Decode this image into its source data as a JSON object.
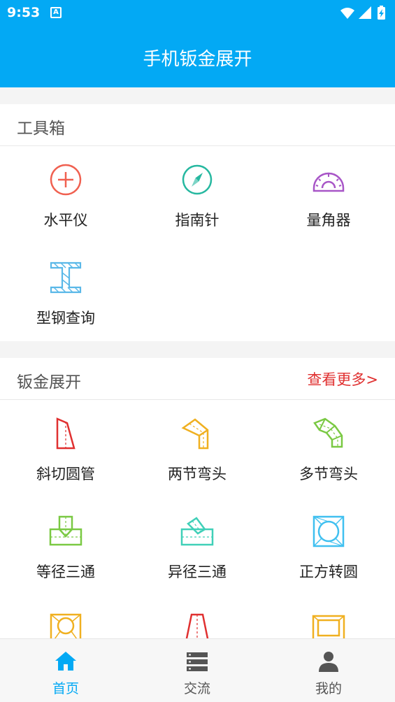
{
  "status_bar": {
    "time": "9:53",
    "notification": "A"
  },
  "app_bar": {
    "title": "手机钣金展开"
  },
  "toolbox": {
    "title": "工具箱",
    "items": [
      {
        "label": "水平仪",
        "icon": "level-icon",
        "color": "#f06050"
      },
      {
        "label": "指南针",
        "icon": "compass-icon",
        "color": "#26b8a0"
      },
      {
        "label": "量角器",
        "icon": "protractor-icon",
        "color": "#a855c7"
      },
      {
        "label": "型钢查询",
        "icon": "steel-beam-icon",
        "color": "#5ab8e8"
      }
    ]
  },
  "sheet_metal": {
    "title": "钣金展开",
    "more_label": "查看更多>",
    "items": [
      {
        "label": "斜切圆管",
        "icon": "oblique-pipe-icon",
        "color": "#e03030"
      },
      {
        "label": "两节弯头",
        "icon": "two-section-elbow-icon",
        "color": "#f0b020"
      },
      {
        "label": "多节弯头",
        "icon": "multi-section-elbow-icon",
        "color": "#7ac943"
      },
      {
        "label": "等径三通",
        "icon": "equal-tee-icon",
        "color": "#7ac943"
      },
      {
        "label": "异径三通",
        "icon": "reducing-tee-icon",
        "color": "#40d0b8"
      },
      {
        "label": "正方转圆",
        "icon": "square-to-round-icon",
        "color": "#40c0f0"
      },
      {
        "label": "",
        "icon": "square-round-frame-icon",
        "color": "#f0b020"
      },
      {
        "label": "",
        "icon": "cone-icon",
        "color": "#e03030"
      },
      {
        "label": "",
        "icon": "rectangle-frame-icon",
        "color": "#f0b020"
      }
    ]
  },
  "bottom_nav": {
    "items": [
      {
        "label": "首页",
        "icon": "home-icon",
        "active": true
      },
      {
        "label": "交流",
        "icon": "server-list-icon",
        "active": false
      },
      {
        "label": "我的",
        "icon": "person-icon",
        "active": false
      }
    ],
    "active_color": "#03a9f4",
    "inactive_color": "#555555"
  },
  "accent_color": "#03a9f4"
}
